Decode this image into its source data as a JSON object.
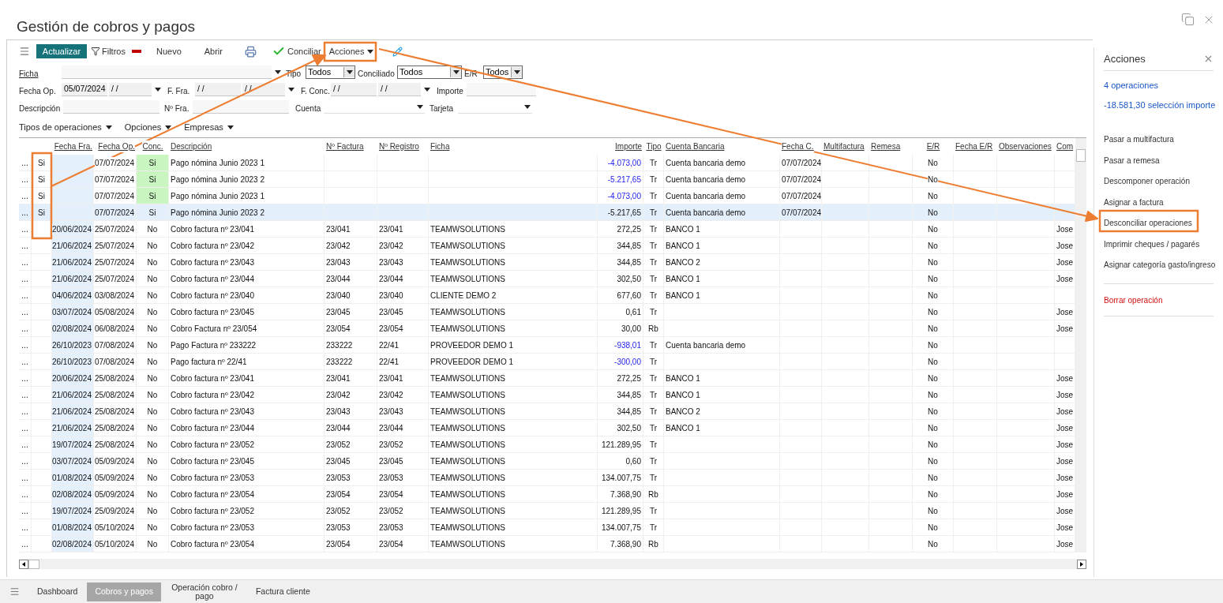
{
  "window": {
    "title": "Gestión de cobros y pagos"
  },
  "toolbar": {
    "refresh": "Actualizar",
    "filters": "Filtros",
    "new": "Nuevo",
    "open": "Abrir",
    "reconcile": "Conciliar",
    "actions": "Acciones"
  },
  "filters": {
    "ficha": {
      "label": "Ficha"
    },
    "tipo": {
      "label": "Tipo",
      "value": "Todos"
    },
    "conciliado": {
      "label": "Conciliado",
      "value": "Todos"
    },
    "er": {
      "label": "E/R",
      "value": "Todos"
    },
    "fecha_op": {
      "label": "Fecha Op.",
      "from": "05/07/2024",
      "to": "/ /"
    },
    "f_fra": {
      "label": "F. Fra.",
      "from": "/ /",
      "to": "/ /"
    },
    "f_conc": {
      "label": "F. Conc.",
      "from": "/ /",
      "to": "/ /"
    },
    "importe": {
      "label": "Importe"
    },
    "descripcion": {
      "label": "Descripción"
    },
    "n_fra": {
      "label": "Nº Fra."
    },
    "cuenta": {
      "label": "Cuenta"
    },
    "tarjeta": {
      "label": "Tarjeta"
    }
  },
  "menus": [
    "Tipos de operaciones",
    "Opciones",
    "Empresas"
  ],
  "table": {
    "columns": [
      "Fecha Fra.",
      "Fecha Op.",
      "Conc.",
      "Descripción",
      "Nº Factura",
      "Nº Registro",
      "Ficha",
      "Importe",
      "Tipo",
      "Cuenta Bancaria",
      "Fecha C.",
      "Multifactura",
      "Remesa",
      "E/R",
      "Fecha E/R",
      "Observaciones",
      "Com"
    ],
    "rows": [
      {
        "selected": false,
        "conc_highlighted": true,
        "importe_highlighted": true,
        "column_1": "...",
        "column_2": "Si",
        "fecha_op": "07/07/2024",
        "conc": "Si",
        "descripcion": "Pago nómina Junio 2023 1",
        "importe": "-4.073,00",
        "tipo": "Tr",
        "cuenta_bancaria": "Cuenta bancaria demo",
        "fecha_c": "07/07/2024",
        "er": "No"
      },
      {
        "selected": false,
        "conc_highlighted": true,
        "importe_highlighted": true,
        "column_1": "...",
        "column_2": "Si",
        "fecha_op": "07/07/2024",
        "conc": "Si",
        "descripcion": "Pago nómina Junio 2023 2",
        "importe": "-5.217,65",
        "tipo": "Tr",
        "cuenta_bancaria": "Cuenta bancaria demo",
        "fecha_c": "07/07/2024",
        "er": "No"
      },
      {
        "selected": false,
        "conc_highlighted": true,
        "importe_highlighted": true,
        "column_1": "...",
        "column_2": "Si",
        "fecha_op": "07/07/2024",
        "conc": "Si",
        "descripcion": "Pago nómina Junio 2023 1",
        "importe": "-4.073,00",
        "tipo": "Tr",
        "cuenta_bancaria": "Cuenta bancaria demo",
        "fecha_c": "07/07/2024",
        "er": "No"
      },
      {
        "selected": true,
        "conc_highlighted": false,
        "importe_highlighted": false,
        "column_1": "...",
        "column_2": "Si",
        "fecha_op": "07/07/2024",
        "conc": "Si",
        "descripcion": "Pago nómina Junio 2023 2",
        "importe": "-5.217,65",
        "tipo": "Tr",
        "cuenta_bancaria": "Cuenta bancaria demo",
        "fecha_c": "07/07/2024",
        "er": "No"
      },
      {
        "selected": false,
        "conc_highlighted": false,
        "importe_highlighted": false,
        "column_1": "...",
        "fecha_fra": "20/06/2024",
        "fecha_op": "25/07/2024",
        "conc": "No",
        "descripcion": "Cobro factura nº 23/041",
        "n_factura": "23/041",
        "n_registro": "23/041",
        "ficha": "TEAMWSOLUTIONS",
        "importe": "272,25",
        "tipo": "Tr",
        "cuenta_bancaria": "BANCO 1",
        "er": "No",
        "com": "Jose"
      },
      {
        "selected": false,
        "conc_highlighted": false,
        "importe_highlighted": false,
        "column_1": "...",
        "fecha_fra": "21/06/2024",
        "fecha_op": "25/07/2024",
        "conc": "No",
        "descripcion": "Cobro factura nº 23/042",
        "n_factura": "23/042",
        "n_registro": "23/042",
        "ficha": "TEAMWSOLUTIONS",
        "importe": "344,85",
        "tipo": "Tr",
        "cuenta_bancaria": "BANCO 1",
        "er": "No",
        "com": "Jose"
      },
      {
        "selected": false,
        "conc_highlighted": false,
        "importe_highlighted": false,
        "column_1": "...",
        "fecha_fra": "21/06/2024",
        "fecha_op": "25/07/2024",
        "conc": "No",
        "descripcion": "Cobro factura nº 23/043",
        "n_factura": "23/043",
        "n_registro": "23/043",
        "ficha": "TEAMWSOLUTIONS",
        "importe": "344,85",
        "tipo": "Tr",
        "cuenta_bancaria": "BANCO 2",
        "er": "No",
        "com": "Jose"
      },
      {
        "selected": false,
        "conc_highlighted": false,
        "importe_highlighted": false,
        "column_1": "...",
        "fecha_fra": "21/06/2024",
        "fecha_op": "25/07/2024",
        "conc": "No",
        "descripcion": "Cobro factura nº 23/044",
        "n_factura": "23/044",
        "n_registro": "23/044",
        "ficha": "TEAMWSOLUTIONS",
        "importe": "302,50",
        "tipo": "Tr",
        "cuenta_bancaria": "BANCO 1",
        "er": "No",
        "com": "Jose"
      },
      {
        "selected": false,
        "conc_highlighted": false,
        "importe_highlighted": false,
        "column_1": "...",
        "fecha_fra": "04/06/2024",
        "fecha_op": "03/08/2024",
        "conc": "No",
        "descripcion": "Cobro factura nº 23/040",
        "n_factura": "23/040",
        "n_registro": "23/040",
        "ficha": "CLIENTE DEMO 2",
        "importe": "677,60",
        "tipo": "Tr",
        "cuenta_bancaria": "BANCO 1",
        "er": "No"
      },
      {
        "selected": false,
        "conc_highlighted": false,
        "importe_highlighted": false,
        "column_1": "...",
        "fecha_fra": "03/07/2024",
        "fecha_op": "05/08/2024",
        "conc": "No",
        "descripcion": "Cobro factura nº 23/045",
        "n_factura": "23/045",
        "n_registro": "23/045",
        "ficha": "TEAMWSOLUTIONS",
        "importe": "0,61",
        "tipo": "Tr",
        "er": "No",
        "com": "Jose"
      },
      {
        "selected": false,
        "conc_highlighted": false,
        "importe_highlighted": false,
        "column_1": "...",
        "fecha_fra": "02/08/2024",
        "fecha_op": "06/08/2024",
        "conc": "No",
        "descripcion": "Cobro Factura nº 23/054",
        "n_factura": "23/054",
        "n_registro": "23/054",
        "ficha": "TEAMWSOLUTIONS",
        "importe": "30,00",
        "tipo": "Rb",
        "er": "No",
        "com": "Jose"
      },
      {
        "selected": false,
        "conc_highlighted": false,
        "importe_highlighted": true,
        "column_1": "...",
        "fecha_fra": "26/10/2023",
        "fecha_op": "07/08/2024",
        "conc": "No",
        "descripcion": "Pago Factura nº 233222",
        "n_factura": "233222",
        "n_registro": "22/41",
        "ficha": "PROVEEDOR DEMO 1",
        "importe": "-938,01",
        "tipo": "Tr",
        "cuenta_bancaria": "Cuenta bancaria demo",
        "er": "No"
      },
      {
        "selected": false,
        "conc_highlighted": false,
        "importe_highlighted": true,
        "column_1": "...",
        "fecha_fra": "26/10/2023",
        "fecha_op": "07/08/2024",
        "conc": "No",
        "descripcion": "Pago factura nº 22/41",
        "n_factura": "233222",
        "n_registro": "22/41",
        "ficha": "PROVEEDOR DEMO 1",
        "importe": "-300,00",
        "tipo": "Tr",
        "er": "No"
      },
      {
        "selected": false,
        "conc_highlighted": false,
        "importe_highlighted": false,
        "column_1": "...",
        "fecha_fra": "20/06/2024",
        "fecha_op": "25/08/2024",
        "conc": "No",
        "descripcion": "Cobro factura nº 23/041",
        "n_factura": "23/041",
        "n_registro": "23/041",
        "ficha": "TEAMWSOLUTIONS",
        "importe": "272,25",
        "tipo": "Tr",
        "cuenta_bancaria": "BANCO 1",
        "er": "No",
        "com": "Jose"
      },
      {
        "selected": false,
        "conc_highlighted": false,
        "importe_highlighted": false,
        "column_1": "...",
        "fecha_fra": "21/06/2024",
        "fecha_op": "25/08/2024",
        "conc": "No",
        "descripcion": "Cobro factura nº 23/042",
        "n_factura": "23/042",
        "n_registro": "23/042",
        "ficha": "TEAMWSOLUTIONS",
        "importe": "344,85",
        "tipo": "Tr",
        "cuenta_bancaria": "BANCO 1",
        "er": "No",
        "com": "Jose"
      },
      {
        "selected": false,
        "conc_highlighted": false,
        "importe_highlighted": false,
        "column_1": "...",
        "fecha_fra": "21/06/2024",
        "fecha_op": "25/08/2024",
        "conc": "No",
        "descripcion": "Cobro factura nº 23/043",
        "n_factura": "23/043",
        "n_registro": "23/043",
        "ficha": "TEAMWSOLUTIONS",
        "importe": "344,85",
        "tipo": "Tr",
        "cuenta_bancaria": "BANCO 2",
        "er": "No",
        "com": "Jose"
      },
      {
        "selected": false,
        "conc_highlighted": false,
        "importe_highlighted": false,
        "column_1": "...",
        "fecha_fra": "21/06/2024",
        "fecha_op": "25/08/2024",
        "conc": "No",
        "descripcion": "Cobro factura nº 23/044",
        "n_factura": "23/044",
        "n_registro": "23/044",
        "ficha": "TEAMWSOLUTIONS",
        "importe": "302,50",
        "tipo": "Tr",
        "cuenta_bancaria": "BANCO 1",
        "er": "No",
        "com": "Jose"
      },
      {
        "selected": false,
        "conc_highlighted": false,
        "importe_highlighted": false,
        "column_1": "...",
        "fecha_fra": "19/07/2024",
        "fecha_op": "25/08/2024",
        "conc": "No",
        "descripcion": "Cobro factura nº 23/052",
        "n_factura": "23/052",
        "n_registro": "23/052",
        "ficha": "TEAMWSOLUTIONS",
        "importe": "121.289,95",
        "tipo": "Tr",
        "er": "No",
        "com": "Jose"
      },
      {
        "selected": false,
        "conc_highlighted": false,
        "importe_highlighted": false,
        "column_1": "...",
        "fecha_fra": "03/07/2024",
        "fecha_op": "05/09/2024",
        "conc": "No",
        "descripcion": "Cobro factura nº 23/045",
        "n_factura": "23/045",
        "n_registro": "23/045",
        "ficha": "TEAMWSOLUTIONS",
        "importe": "0,60",
        "tipo": "Tr",
        "er": "No",
        "com": "Jose"
      },
      {
        "selected": false,
        "conc_highlighted": false,
        "importe_highlighted": false,
        "column_1": "...",
        "fecha_fra": "01/08/2024",
        "fecha_op": "05/09/2024",
        "conc": "No",
        "descripcion": "Cobro factura nº 23/053",
        "n_factura": "23/053",
        "n_registro": "23/053",
        "ficha": "TEAMWSOLUTIONS",
        "importe": "134.007,75",
        "tipo": "Tr",
        "er": "No",
        "com": "Jose"
      },
      {
        "selected": false,
        "conc_highlighted": false,
        "importe_highlighted": false,
        "column_1": "...",
        "fecha_fra": "02/08/2024",
        "fecha_op": "05/09/2024",
        "conc": "No",
        "descripcion": "Cobro factura nº 23/054",
        "n_factura": "23/054",
        "n_registro": "23/054",
        "ficha": "TEAMWSOLUTIONS",
        "importe": "7.368,90",
        "tipo": "Rb",
        "er": "No",
        "com": "Jose"
      },
      {
        "selected": false,
        "conc_highlighted": false,
        "importe_highlighted": false,
        "column_1": "...",
        "fecha_fra": "19/07/2024",
        "fecha_op": "25/09/2024",
        "conc": "No",
        "descripcion": "Cobro factura nº 23/052",
        "n_factura": "23/052",
        "n_registro": "23/052",
        "ficha": "TEAMWSOLUTIONS",
        "importe": "121.289,95",
        "tipo": "Tr",
        "er": "No",
        "com": "Jose"
      },
      {
        "selected": false,
        "conc_highlighted": false,
        "importe_highlighted": false,
        "column_1": "...",
        "fecha_fra": "01/08/2024",
        "fecha_op": "05/10/2024",
        "conc": "No",
        "descripcion": "Cobro factura nº 23/053",
        "n_factura": "23/053",
        "n_registro": "23/053",
        "ficha": "TEAMWSOLUTIONS",
        "importe": "134.007,75",
        "tipo": "Tr",
        "er": "No",
        "com": "Jose"
      },
      {
        "selected": false,
        "conc_highlighted": false,
        "importe_highlighted": false,
        "column_1": "...",
        "fecha_fra": "02/08/2024",
        "fecha_op": "05/10/2024",
        "conc": "No",
        "descripcion": "Cobro factura nº 23/054",
        "n_factura": "23/054",
        "n_registro": "23/054",
        "ficha": "TEAMWSOLUTIONS",
        "importe": "7.368,90",
        "tipo": "Rb",
        "er": "No",
        "com": "Jose"
      }
    ]
  },
  "panel": {
    "title": "Acciones",
    "summary": [
      "4 operaciones",
      "-18.581,30 selección importe"
    ],
    "items": [
      {
        "label": "Pasar a multifactura",
        "kind": "action"
      },
      {
        "label": "Pasar a remesa",
        "kind": "action"
      },
      {
        "label": "Descomponer operación",
        "kind": "action"
      },
      {
        "label": "Asignar a factura",
        "kind": "action"
      },
      {
        "label": "Desconciliar operaciones",
        "kind": "action"
      },
      {
        "label": "Imprimir cheques / pagarés",
        "kind": "action"
      },
      {
        "label": "Asignar categoría gasto/ingreso",
        "kind": "action"
      },
      {
        "label": "Borrar operación",
        "kind": "danger"
      }
    ]
  },
  "bottom_tabs": [
    {
      "label": "Dashboard",
      "selected": false
    },
    {
      "label": "Cobros y pagos",
      "selected": true
    },
    {
      "label": "Operación cobro / pago",
      "selected": false
    },
    {
      "label": "Factura cliente",
      "selected": false
    }
  ]
}
